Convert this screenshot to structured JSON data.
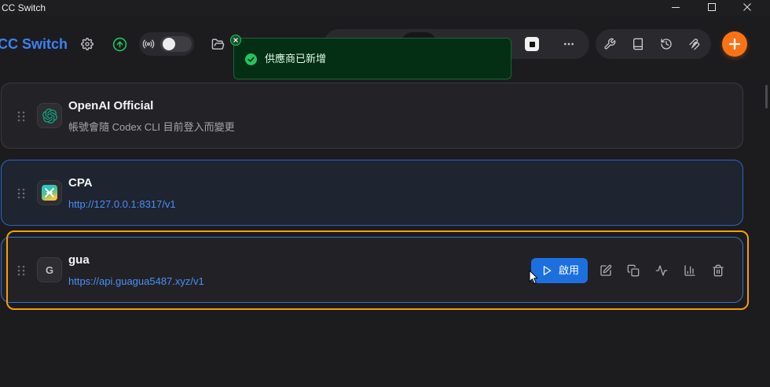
{
  "window": {
    "title": "CC Switch",
    "controls": {
      "minimize_icon": "minimize-icon",
      "maximize_icon": "maximize-icon",
      "close_icon": "close-icon"
    }
  },
  "header": {
    "app_name": "CC Switch",
    "settings_icon": "gear-icon",
    "update_icon": "arrow-up-circle-icon",
    "proxy": {
      "icon": "broadcast-icon",
      "enabled": false
    },
    "folder_icon": "folder-open-icon",
    "app_switcher": {
      "icons": [
        "app-tab-icon",
        "app-tab-icon",
        "app-tab-icon",
        "app-tab-icon",
        "square-app-icon"
      ],
      "more_icon": "more-horizontal-icon"
    },
    "tools": [
      "wrench-icon",
      "book-icon",
      "history-icon",
      "layers-icon"
    ],
    "add_icon": "plus-icon"
  },
  "toast": {
    "type": "success",
    "icon": "check-circle-icon",
    "message": "供應商已新增",
    "close_icon": "close-icon"
  },
  "providers": [
    {
      "name": "OpenAI Official",
      "subtitle": "帳號會隨 Codex CLI 目前登入而變更",
      "icon": "openai-logo-icon",
      "current": false
    },
    {
      "name": "CPA",
      "subtitle": "http://127.0.0.1:8317/v1",
      "icon": "cpa-logo-icon",
      "current": true
    },
    {
      "name": "gua",
      "initial": "G",
      "subtitle": "https://api.guagua5487.xyz/v1",
      "icon": "letter-avatar",
      "current": false,
      "actions": {
        "enable_label": "啟用",
        "enable_icon": "play-icon",
        "icons": [
          "edit-icon",
          "copy-icon",
          "activity-icon",
          "bar-chart-icon",
          "trash-icon"
        ]
      }
    }
  ],
  "colors": {
    "background": "#1c1c1f",
    "accent": "#3b82f6",
    "link": "#4a8ef5",
    "enable_button": "#1d6fe0",
    "success": "#22c55e",
    "toast_bg": "#042f14",
    "add_button": "#f97316",
    "highlight_outline": "#f59e0b",
    "current_border": "#2f64c0"
  }
}
